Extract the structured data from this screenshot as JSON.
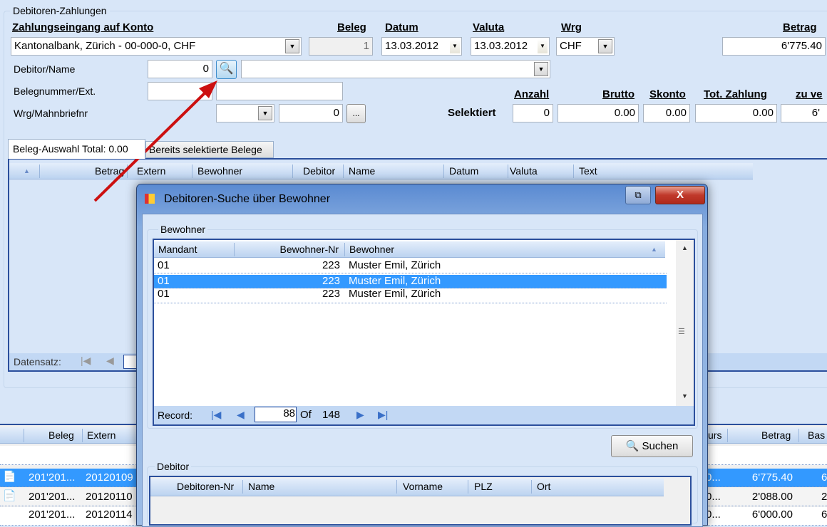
{
  "group_title": "Debitoren-Zahlungen",
  "header": {
    "konto": "Zahlungseingang auf Konto",
    "beleg": "Beleg",
    "datum": "Datum",
    "valuta": "Valuta",
    "wrg": "Wrg",
    "betrag": "Betrag"
  },
  "fields": {
    "konto": "Kantonalbank, Zürich - 00-000-0, CHF",
    "beleg": "1",
    "datum": "13.03.2012",
    "valuta": "13.03.2012",
    "wrg": "CHF",
    "betrag": "6'775.40",
    "debitor_label": "Debitor/Name",
    "debitor": "0",
    "debitor_name": "",
    "belegnr_label": "Belegnummer/Ext.",
    "belegnr": "",
    "ext": "",
    "mahn_label": "Wrg/Mahnbriefnr",
    "mahn_wrg": "",
    "mahn_nr": "0",
    "more_button": "..."
  },
  "summary": {
    "label": "Selektiert",
    "headers": [
      "Anzahl",
      "Brutto",
      "Skonto",
      "Tot. Zahlung",
      "zu ve"
    ],
    "values": [
      "0",
      "0.00",
      "0.00",
      "0.00",
      "6'"
    ]
  },
  "tabs": [
    "Beleg-Auswahl Total: 0.00",
    "Bereits selektierte Belege"
  ],
  "top_grid": {
    "columns": [
      "Betrag",
      "Extern",
      "Bewohner",
      "Debitor",
      "Name",
      "Datum",
      "Valuta",
      "Text"
    ],
    "nav_label": "Datensatz:"
  },
  "bottom_grid": {
    "columns": [
      "Beleg",
      "Extern",
      "urs",
      "Betrag",
      "Bas"
    ],
    "rows": [
      {
        "beleg": "",
        "extern": "",
        "kurs": "",
        "betrag": "",
        "bas": ""
      },
      {
        "beleg": "201'201...",
        "extern": "20120109",
        "kurs": "0...",
        "betrag": "6'775.40",
        "bas": "6"
      },
      {
        "beleg": "201'201...",
        "extern": "20120110",
        "kurs": "0...",
        "betrag": "2'088.00",
        "bas": "2"
      },
      {
        "beleg": "201'201...",
        "extern": "20120114",
        "kurs": "0...",
        "betrag": "6'000.00",
        "bas": "6"
      }
    ]
  },
  "dialog": {
    "title": "Debitoren-Suche über Bewohner",
    "close": "X",
    "bewohner_group": "Bewohner",
    "bewohner_columns": [
      "Mandant",
      "Bewohner-Nr",
      "Bewohner"
    ],
    "bewohner_rows": [
      {
        "mandant": "01",
        "nr": "223",
        "name": "Muster Emil, Zürich"
      },
      {
        "mandant": "01",
        "nr": "223",
        "name": "Muster Emil, Zürich"
      },
      {
        "mandant": "01",
        "nr": "223",
        "name": "Muster Emil, Zürich"
      }
    ],
    "record_label": "Record:",
    "record_current": "88",
    "record_of": "Of",
    "record_total": "148",
    "search_button": "Suchen",
    "debitor_group": "Debitor",
    "debitor_columns": [
      "Debitoren-Nr",
      "Name",
      "Vorname",
      "PLZ",
      "Ort"
    ]
  },
  "colors": {
    "selection": "#3399ff",
    "arrow": "#cc1010",
    "title_bar": "#5a8ad2"
  }
}
